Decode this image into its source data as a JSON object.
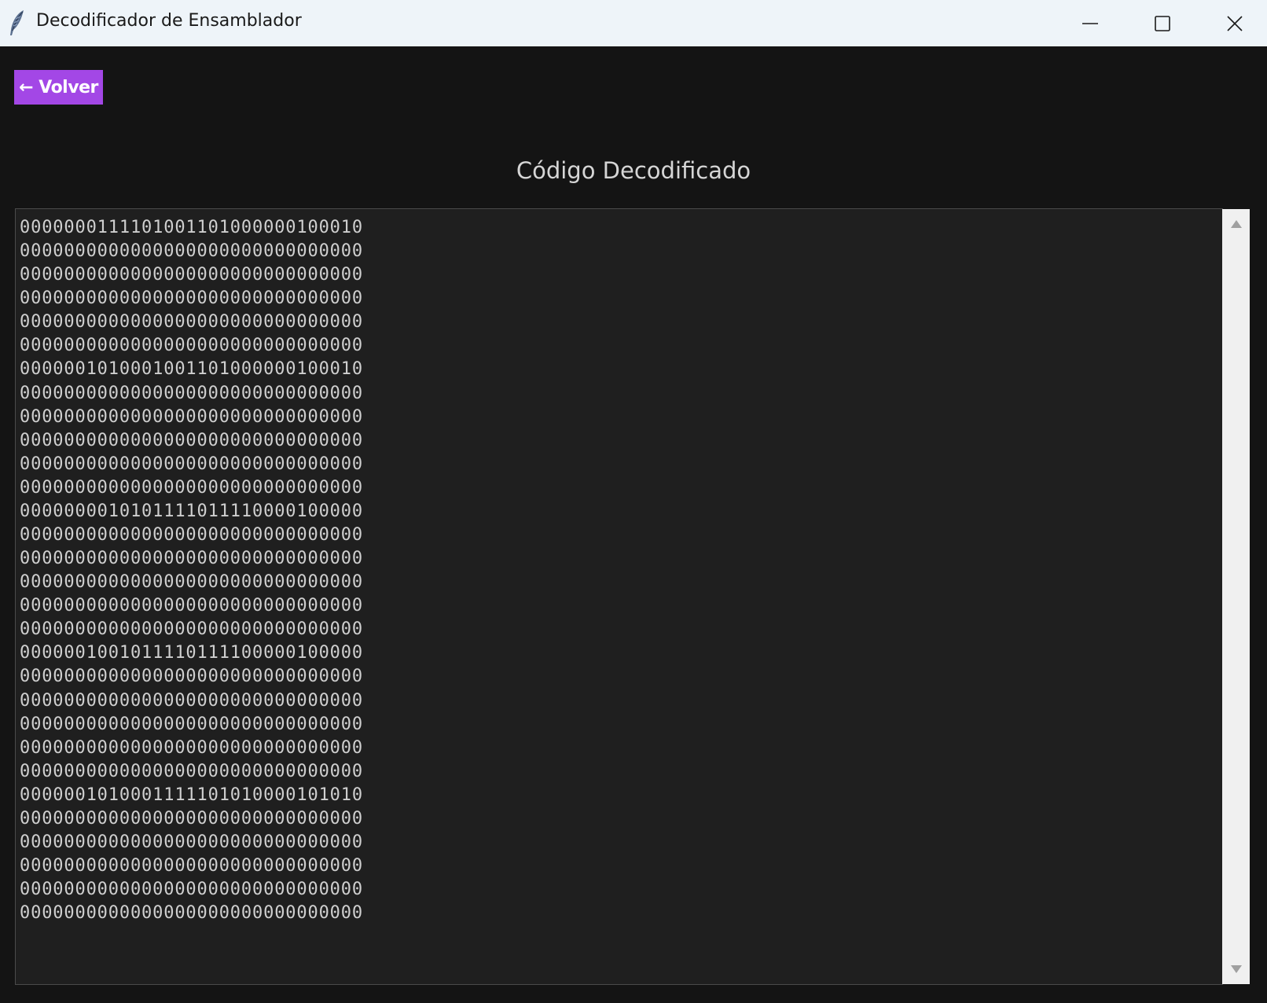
{
  "window": {
    "title": "Decodificador de Ensamblador",
    "controls": {
      "minimize": "minimize-icon",
      "maximize": "maximize-icon",
      "close": "close-icon"
    }
  },
  "toolbar": {
    "back_label": "← Volver",
    "back_color": "#a347e6"
  },
  "main": {
    "title": "Código Decodificado",
    "lines": [
      "0000000111101001101000000100010",
      "0000000000000000000000000000000",
      "0000000000000000000000000000000",
      "0000000000000000000000000000000",
      "0000000000000000000000000000000",
      "0000000000000000000000000000000",
      "0000001010001001101000000100010",
      "0000000000000000000000000000000",
      "0000000000000000000000000000000",
      "0000000000000000000000000000000",
      "0000000000000000000000000000000",
      "0000000000000000000000000000000",
      "0000000010101111011110000100000",
      "0000000000000000000000000000000",
      "0000000000000000000000000000000",
      "0000000000000000000000000000000",
      "0000000000000000000000000000000",
      "0000000000000000000000000000000",
      "0000001001011110111100000100000",
      "0000000000000000000000000000000",
      "0000000000000000000000000000000",
      "0000000000000000000000000000000",
      "0000000000000000000000000000000",
      "0000000000000000000000000000000",
      "0000001010001111101010000101010",
      "0000000000000000000000000000000",
      "0000000000000000000000000000000",
      "0000000000000000000000000000000",
      "0000000000000000000000000000000",
      "0000000000000000000000000000000"
    ]
  },
  "scrollbar": {
    "up": "scroll-up-arrow-icon",
    "down": "scroll-down-arrow-icon"
  }
}
